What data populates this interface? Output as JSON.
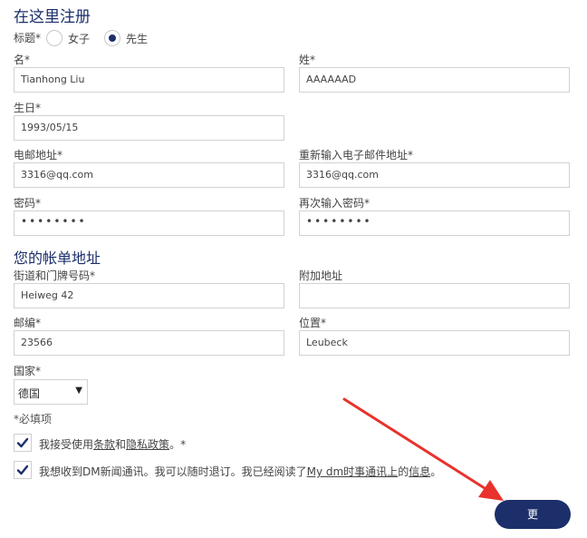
{
  "page": {
    "register_title": "在这里注册",
    "billing_title": "您的帐单地址"
  },
  "title_field": {
    "label": "标题",
    "required_mark": "*",
    "option_female": "女子",
    "option_male": "先生",
    "selected": "先生"
  },
  "first_name": {
    "label": "名",
    "required_mark": "*",
    "value": "Tianhong Liu"
  },
  "last_name": {
    "label": "姓",
    "required_mark": "*",
    "value": "AAAAAAD"
  },
  "birthday": {
    "label": "生日",
    "required_mark": "*",
    "value": "1993/05/15"
  },
  "email": {
    "label": "电邮地址",
    "required_mark": "*",
    "value": "3316@qq.com"
  },
  "email_confirm": {
    "label": "重新输入电子邮件地址",
    "required_mark": "*",
    "value": "3316@qq.com"
  },
  "password": {
    "label": "密码",
    "required_mark": "*",
    "value": "••••••••"
  },
  "password_confirm": {
    "label": "再次输入密码",
    "required_mark": "*",
    "value": "••••••••"
  },
  "street": {
    "label": "街道和门牌号码",
    "required_mark": "*",
    "value": "Heiweg  42"
  },
  "additional_address": {
    "label": "附加地址",
    "value": ""
  },
  "postcode": {
    "label": "邮编",
    "required_mark": "*",
    "value": "23566"
  },
  "city": {
    "label": "位置",
    "required_mark": "*",
    "value": "Leubeck"
  },
  "country": {
    "label": "国家",
    "required_mark": "*",
    "value": "德国"
  },
  "required_note": "*必填项",
  "terms": {
    "checked": true,
    "text_a": "我接受使用",
    "link_terms": "条款",
    "text_b": "和",
    "link_privacy": "隐私政策",
    "text_c": "。*"
  },
  "newsletter": {
    "checked": true,
    "text_a": "我想收到DM新闻通讯。我可以随时退订。我已经阅读了",
    "link_a": "My dm时事通讯上",
    "text_b": "的",
    "link_b": "信息",
    "text_c": "。"
  },
  "submit_label": "更",
  "colors": {
    "accent": "#1c2f6b",
    "annotation_arrow": "#e8322b"
  }
}
